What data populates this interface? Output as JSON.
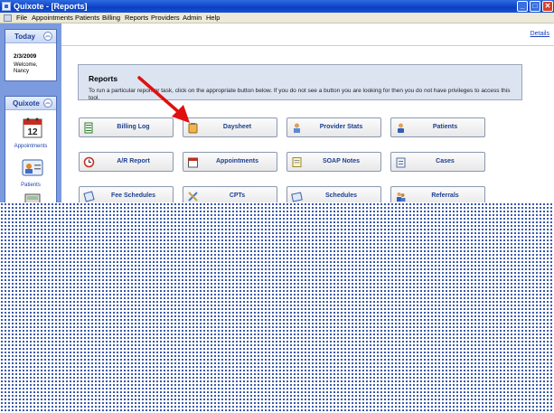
{
  "window": {
    "title": "Quixote - [Reports]",
    "controls": {
      "minimize": "_",
      "maximize": "□",
      "close": "✕"
    }
  },
  "menu": {
    "items": [
      "File",
      "Appointments",
      "Patients",
      "Billing",
      "Reports",
      "Providers",
      "Admin",
      "Help"
    ]
  },
  "sidebar": {
    "today": {
      "header": "Today",
      "date": "2/3/2009",
      "welcome_line1": "Welcome,",
      "welcome_line2": "Nancy"
    },
    "quixote": {
      "header": "Quixote",
      "items": [
        {
          "label": "Appointments",
          "icon": "calendar-icon",
          "calendar_number": "12"
        },
        {
          "label": "Patients",
          "icon": "patient-card-icon"
        },
        {
          "label": "",
          "icon": "calculator-icon"
        }
      ]
    }
  },
  "top_link": {
    "label": "Details"
  },
  "reports": {
    "title": "Reports",
    "description": "To run a particular report or task, click on the appropriate button below.  If you do not see a button you are looking for then you do not have privileges to access this tool.",
    "buttons": [
      {
        "label": "Billing Log",
        "icon": "ledger-icon"
      },
      {
        "label": "Daysheet",
        "icon": "clipboard-icon"
      },
      {
        "label": "Provider Stats",
        "icon": "provider-icon"
      },
      {
        "label": "Patients",
        "icon": "person-icon"
      },
      {
        "label": "A/R Report",
        "icon": "clock-icon"
      },
      {
        "label": "Appointments",
        "icon": "calendar-icon"
      },
      {
        "label": "SOAP Notes",
        "icon": "notes-icon"
      },
      {
        "label": "Cases",
        "icon": "cases-icon"
      },
      {
        "label": "Fee Schedules",
        "icon": "fee-schedule-icon"
      },
      {
        "label": "CPTs",
        "icon": "tools-icon"
      },
      {
        "label": "Schedules",
        "icon": "schedule-icon"
      },
      {
        "label": "Referrals",
        "icon": "referrals-icon"
      }
    ]
  },
  "colors": {
    "titlebar": "#0a3fc4",
    "sidebar": "#7b9bde",
    "panel": "#dce4f1",
    "arrow": "#e01010",
    "button_text": "#1d3f8f"
  }
}
